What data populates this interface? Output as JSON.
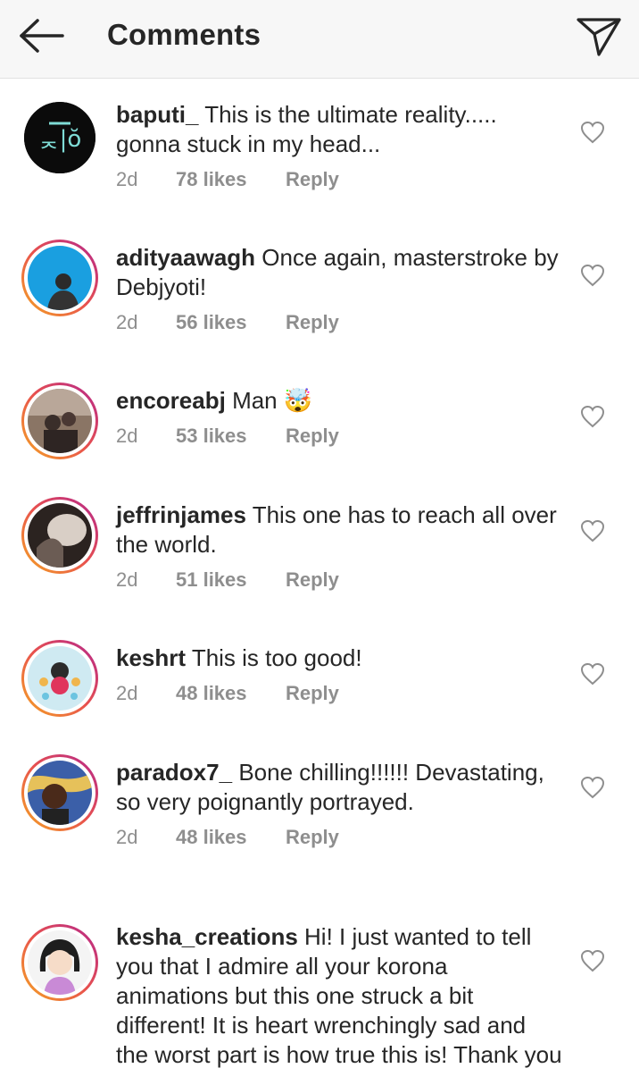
{
  "header": {
    "title": "Comments",
    "back_icon": "arrow-left-icon",
    "send_icon": "direct-send-icon"
  },
  "colors": {
    "text": "#262626",
    "secondary": "#8e8e8e",
    "story_ring": [
      "#f5a623",
      "#e8514e",
      "#b4268d"
    ]
  },
  "comments": [
    {
      "username": "baputi_",
      "text": "This is the ultimate reality..... gonna stuck in my head...",
      "time": "2d",
      "likes": "78 likes",
      "reply": "Reply",
      "avatar_ring": false
    },
    {
      "username": "adityaawagh",
      "text": "Once again, masterstroke by Debjyoti!",
      "time": "2d",
      "likes": "56 likes",
      "reply": "Reply",
      "avatar_ring": true
    },
    {
      "username": "encoreabj",
      "text": "Man 🤯",
      "time": "2d",
      "likes": "53 likes",
      "reply": "Reply",
      "avatar_ring": true
    },
    {
      "username": "jeffrinjames",
      "text": "This one has to reach all over the world.",
      "time": "2d",
      "likes": "51 likes",
      "reply": "Reply",
      "avatar_ring": true
    },
    {
      "username": "keshrt",
      "text": "This is too good!",
      "time": "2d",
      "likes": "48 likes",
      "reply": "Reply",
      "avatar_ring": true
    },
    {
      "username": "paradox7_",
      "text": "Bone chilling!!!!!! Devastating, so very poignantly portrayed.",
      "time": "2d",
      "likes": "48 likes",
      "reply": "Reply",
      "avatar_ring": true
    },
    {
      "username": "kesha_creations",
      "text": "Hi! I just wanted to tell you that I admire all your korona animations but this one struck a bit different! It is heart wrenchingly sad and the worst part is how true this is! Thank you",
      "time": "",
      "likes": "",
      "reply": "",
      "avatar_ring": true
    }
  ]
}
